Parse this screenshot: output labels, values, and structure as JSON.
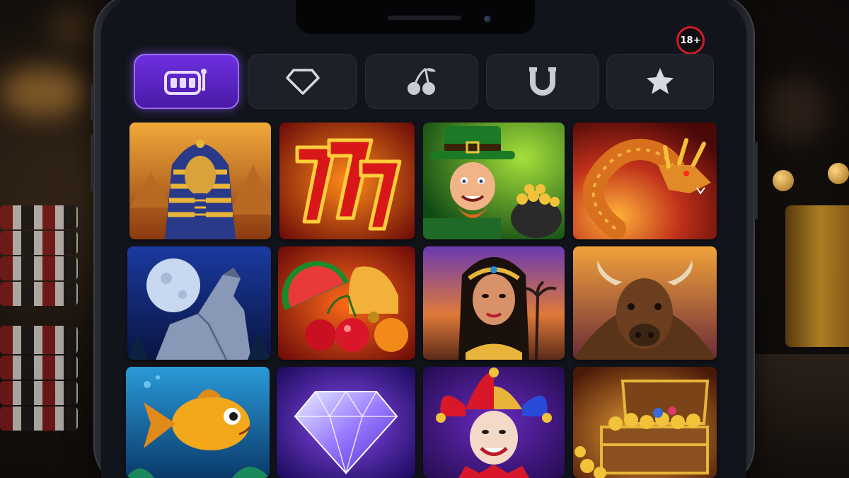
{
  "age_badge": "18+",
  "colors": {
    "accent": "#6d2fe0",
    "accent_border": "#9a6cff",
    "tab_bg": "#1d2029",
    "screen_bg": "#12141b",
    "badge_red": "#d21d25"
  },
  "category_tabs": [
    {
      "icon": "slot-machine-icon",
      "active": true
    },
    {
      "icon": "diamond-icon",
      "active": false
    },
    {
      "icon": "cherries-icon",
      "active": false
    },
    {
      "icon": "horseshoe-icon",
      "active": false
    },
    {
      "icon": "star-icon",
      "active": false
    }
  ],
  "games": [
    {
      "theme": "pharaoh"
    },
    {
      "theme": "lucky-777"
    },
    {
      "theme": "leprechaun"
    },
    {
      "theme": "dragon"
    },
    {
      "theme": "howling-wolf"
    },
    {
      "theme": "fruits-and-bell"
    },
    {
      "theme": "cleopatra"
    },
    {
      "theme": "buffalo"
    },
    {
      "theme": "golden-fish"
    },
    {
      "theme": "diamond"
    },
    {
      "theme": "jester"
    },
    {
      "theme": "treasure-chest"
    }
  ]
}
